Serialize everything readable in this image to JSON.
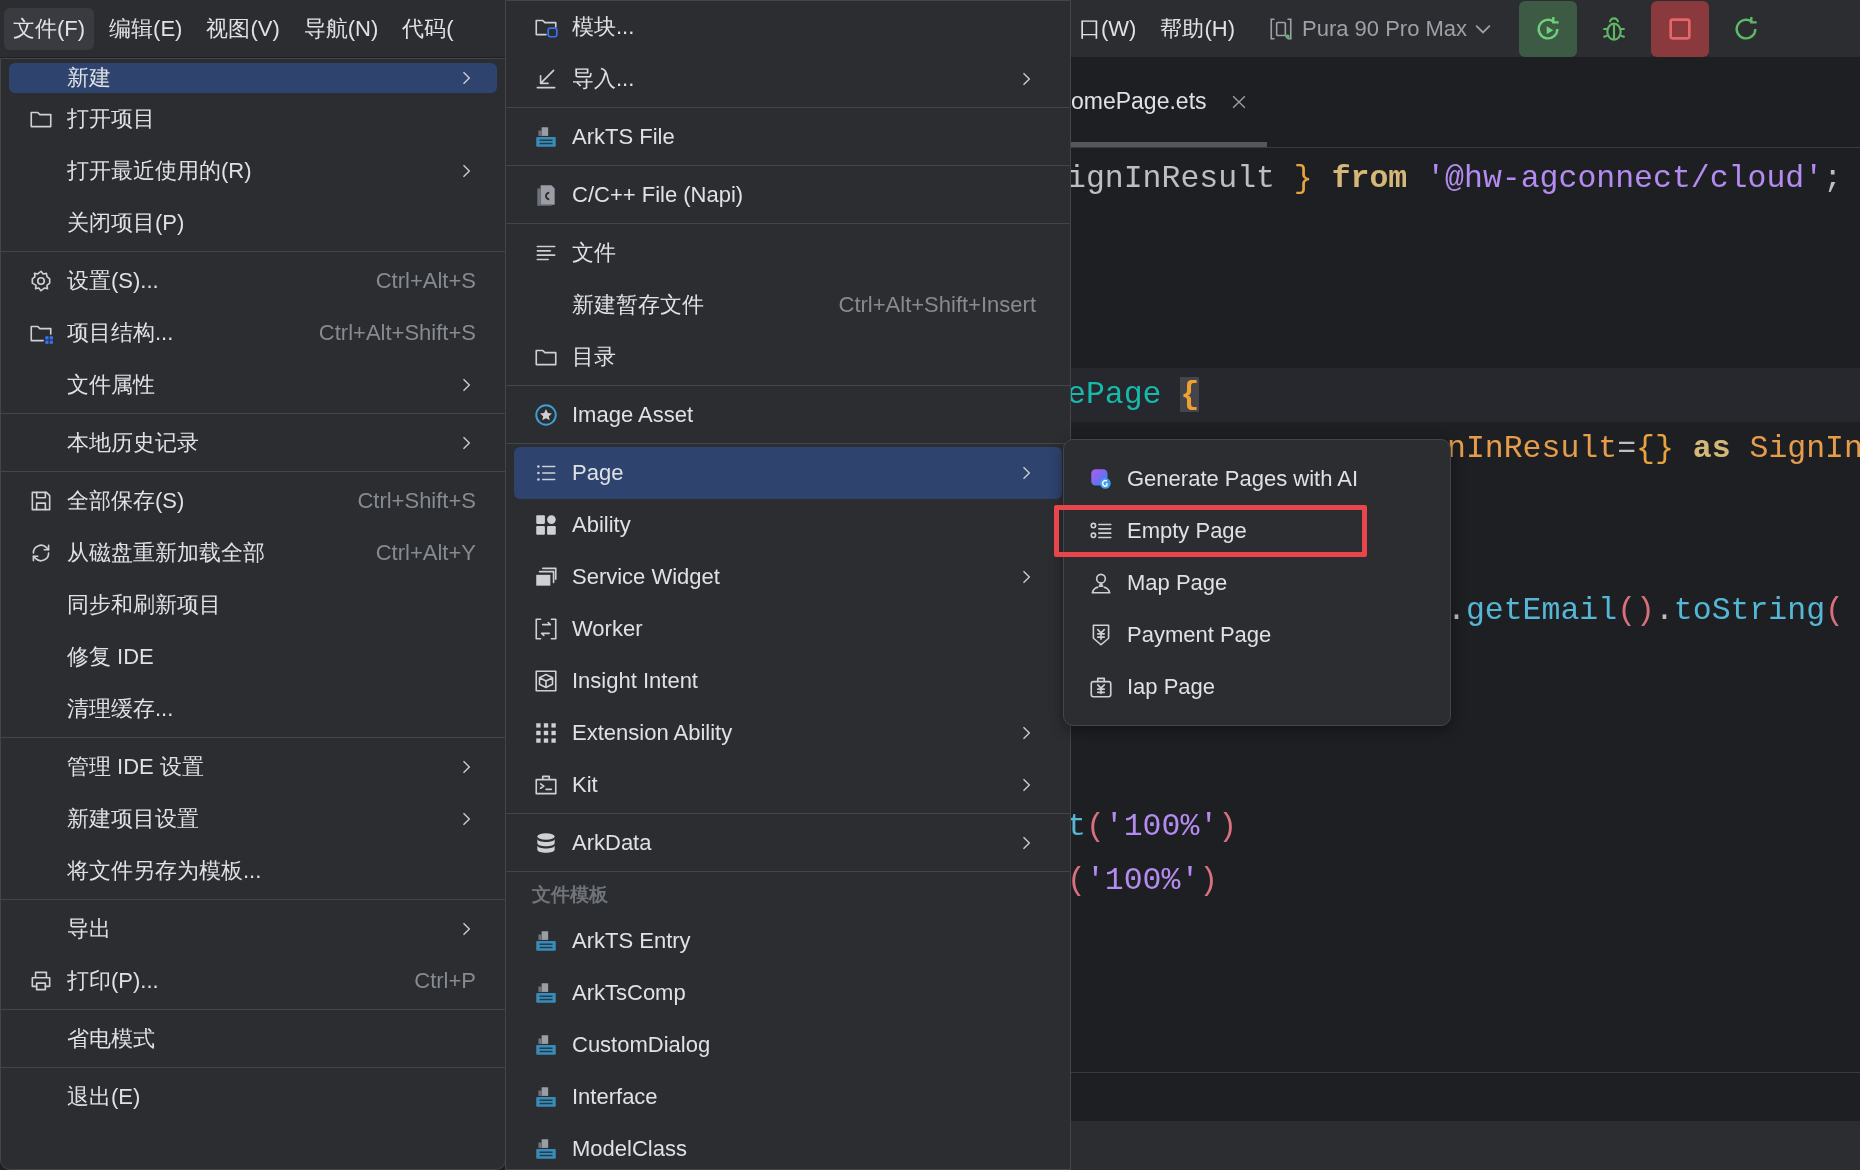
{
  "menubar": {
    "items": [
      {
        "label": "文件(F)",
        "selected": true
      },
      {
        "label": "编辑(E)",
        "selected": false
      },
      {
        "label": "视图(V)",
        "selected": false
      },
      {
        "label": "导航(N)",
        "selected": false
      },
      {
        "label": "代码(",
        "selected": false
      }
    ],
    "items_right": [
      {
        "label": "口(W)",
        "selected": false
      },
      {
        "label": "帮助(H)",
        "selected": false
      }
    ],
    "device": "Pura 90 Pro Max"
  },
  "file_menu": {
    "items": [
      {
        "kind": "item",
        "label": "新建",
        "submenu": true,
        "selected": true
      },
      {
        "kind": "item",
        "label": "打开项目",
        "submenu": false,
        "selected": false
      },
      {
        "kind": "item",
        "label": "打开最近使用的(R)",
        "submenu": true,
        "selected": false
      },
      {
        "kind": "item",
        "label": "关闭项目(P)",
        "submenu": false,
        "selected": false
      },
      {
        "kind": "separator"
      },
      {
        "kind": "item",
        "label": "设置(S)...",
        "shortcut": "Ctrl+Alt+S",
        "submenu": false,
        "selected": false
      },
      {
        "kind": "item",
        "label": "项目结构...",
        "shortcut": "Ctrl+Alt+Shift+S",
        "submenu": false,
        "selected": false
      },
      {
        "kind": "item",
        "label": "文件属性",
        "submenu": true,
        "selected": false
      },
      {
        "kind": "separator"
      },
      {
        "kind": "item",
        "label": "本地历史记录",
        "submenu": true,
        "selected": false
      },
      {
        "kind": "separator"
      },
      {
        "kind": "item",
        "label": "全部保存(S)",
        "shortcut": "Ctrl+Shift+S",
        "submenu": false,
        "selected": false
      },
      {
        "kind": "item",
        "label": "从磁盘重新加载全部",
        "shortcut": "Ctrl+Alt+Y",
        "submenu": false,
        "selected": false
      },
      {
        "kind": "item",
        "label": "同步和刷新项目",
        "submenu": false,
        "selected": false
      },
      {
        "kind": "item",
        "label": "修复 IDE",
        "submenu": false,
        "selected": false
      },
      {
        "kind": "item",
        "label": "清理缓存...",
        "submenu": false,
        "selected": false
      },
      {
        "kind": "separator"
      },
      {
        "kind": "item",
        "label": "管理 IDE 设置",
        "submenu": true,
        "selected": false
      },
      {
        "kind": "item",
        "label": "新建项目设置",
        "submenu": true,
        "selected": false
      },
      {
        "kind": "item",
        "label": "将文件另存为模板...",
        "submenu": false,
        "selected": false
      },
      {
        "kind": "separator"
      },
      {
        "kind": "item",
        "label": "导出",
        "submenu": true,
        "selected": false
      },
      {
        "kind": "item",
        "label": "打印(P)...",
        "shortcut": "Ctrl+P",
        "submenu": false,
        "selected": false
      },
      {
        "kind": "separator"
      },
      {
        "kind": "item",
        "label": "省电模式",
        "submenu": false,
        "selected": false
      },
      {
        "kind": "separator"
      },
      {
        "kind": "item",
        "label": "退出(E)",
        "submenu": false,
        "selected": false
      }
    ]
  },
  "new_menu": {
    "items": [
      {
        "kind": "item",
        "label": "模块...",
        "submenu": false,
        "selected": false
      },
      {
        "kind": "item",
        "label": "导入...",
        "submenu": true,
        "selected": false
      },
      {
        "kind": "separator"
      },
      {
        "kind": "item",
        "label": "ArkTS File",
        "submenu": false,
        "selected": false
      },
      {
        "kind": "separator"
      },
      {
        "kind": "item",
        "label": "C/C++ File (Napi)",
        "submenu": false,
        "selected": false
      },
      {
        "kind": "separator"
      },
      {
        "kind": "item",
        "label": "文件",
        "submenu": false,
        "selected": false
      },
      {
        "kind": "item",
        "label": "新建暂存文件",
        "shortcut": "Ctrl+Alt+Shift+Insert",
        "submenu": false,
        "selected": false
      },
      {
        "kind": "item",
        "label": "目录",
        "submenu": false,
        "selected": false
      },
      {
        "kind": "separator"
      },
      {
        "kind": "item",
        "label": "Image Asset",
        "submenu": false,
        "selected": false
      },
      {
        "kind": "separator"
      },
      {
        "kind": "item",
        "label": "Page",
        "submenu": true,
        "selected": true
      },
      {
        "kind": "item",
        "label": "Ability",
        "submenu": false,
        "selected": false
      },
      {
        "kind": "item",
        "label": "Service Widget",
        "submenu": true,
        "selected": false
      },
      {
        "kind": "item",
        "label": "Worker",
        "submenu": false,
        "selected": false
      },
      {
        "kind": "item",
        "label": "Insight Intent",
        "submenu": false,
        "selected": false
      },
      {
        "kind": "item",
        "label": "Extension Ability",
        "submenu": true,
        "selected": false
      },
      {
        "kind": "item",
        "label": "Kit",
        "submenu": true,
        "selected": false
      },
      {
        "kind": "separator"
      },
      {
        "kind": "item",
        "label": "ArkData",
        "submenu": true,
        "selected": false
      },
      {
        "kind": "separator"
      },
      {
        "kind": "header",
        "label": "文件模板"
      },
      {
        "kind": "item",
        "label": "ArkTS Entry",
        "submenu": false,
        "selected": false
      },
      {
        "kind": "item",
        "label": "ArkTsComp",
        "submenu": false,
        "selected": false
      },
      {
        "kind": "item",
        "label": "CustomDialog",
        "submenu": false,
        "selected": false
      },
      {
        "kind": "item",
        "label": "Interface",
        "submenu": false,
        "selected": false
      },
      {
        "kind": "item",
        "label": "ModelClass",
        "submenu": false,
        "selected": false
      }
    ]
  },
  "page_submenu": {
    "items": [
      {
        "label": "Generate Pages with AI",
        "highlighted": false
      },
      {
        "label": "Empty Page",
        "highlighted": true
      },
      {
        "label": "Map Page",
        "highlighted": false
      },
      {
        "label": "Payment Page",
        "highlighted": false
      },
      {
        "label": "Iap Page",
        "highlighted": false
      }
    ]
  },
  "editor": {
    "tab": {
      "label": "omePage.ets"
    },
    "lines": [
      {
        "kind": "code",
        "current": false,
        "behind_popup": false,
        "tokens": [
          {
            "text": "ignInResult ",
            "kind": "plain"
          },
          {
            "text": "}",
            "kind": "brace"
          },
          {
            "text": " from ",
            "kind": "keyword"
          },
          {
            "text": "'@hw-agconnect/cloud'",
            "kind": "string"
          },
          {
            "text": ";",
            "kind": "plain"
          }
        ]
      },
      {
        "kind": "blank"
      },
      {
        "kind": "blank"
      },
      {
        "kind": "blank"
      },
      {
        "kind": "code",
        "current": true,
        "behind_popup": false,
        "tokens": [
          {
            "text": "ePage ",
            "kind": "name"
          },
          {
            "text": "{",
            "kind": "brace_match"
          }
        ]
      },
      {
        "kind": "code",
        "current": false,
        "behind_popup": true,
        "tokens": [
          {
            "text": "nInResult",
            "kind": "var"
          },
          {
            "text": "=",
            "kind": "plain"
          },
          {
            "text": "{}",
            "kind": "brace"
          },
          {
            "text": " as ",
            "kind": "keyword"
          },
          {
            "text": "SignIn",
            "kind": "var"
          }
        ]
      },
      {
        "kind": "blank"
      },
      {
        "kind": "blank"
      },
      {
        "kind": "code",
        "current": false,
        "behind_popup": true,
        "tokens": [
          {
            "text": ".",
            "kind": "plain"
          },
          {
            "text": "getEmail",
            "kind": "func"
          },
          {
            "text": "()",
            "kind": "paren"
          },
          {
            "text": ".",
            "kind": "plain"
          },
          {
            "text": "toString",
            "kind": "func"
          },
          {
            "text": "(",
            "kind": "paren"
          }
        ]
      },
      {
        "kind": "blank"
      },
      {
        "kind": "blank"
      },
      {
        "kind": "blank"
      },
      {
        "kind": "code",
        "current": false,
        "behind_popup": false,
        "tokens": [
          {
            "text": "t",
            "kind": "func"
          },
          {
            "text": "(",
            "kind": "paren"
          },
          {
            "text": "'100%'",
            "kind": "string"
          },
          {
            "text": ")",
            "kind": "paren"
          }
        ]
      },
      {
        "kind": "code",
        "current": false,
        "behind_popup": false,
        "tokens": [
          {
            "text": "(",
            "kind": "paren"
          },
          {
            "text": "'100%'",
            "kind": "string"
          },
          {
            "text": ")",
            "kind": "paren"
          }
        ]
      }
    ]
  }
}
